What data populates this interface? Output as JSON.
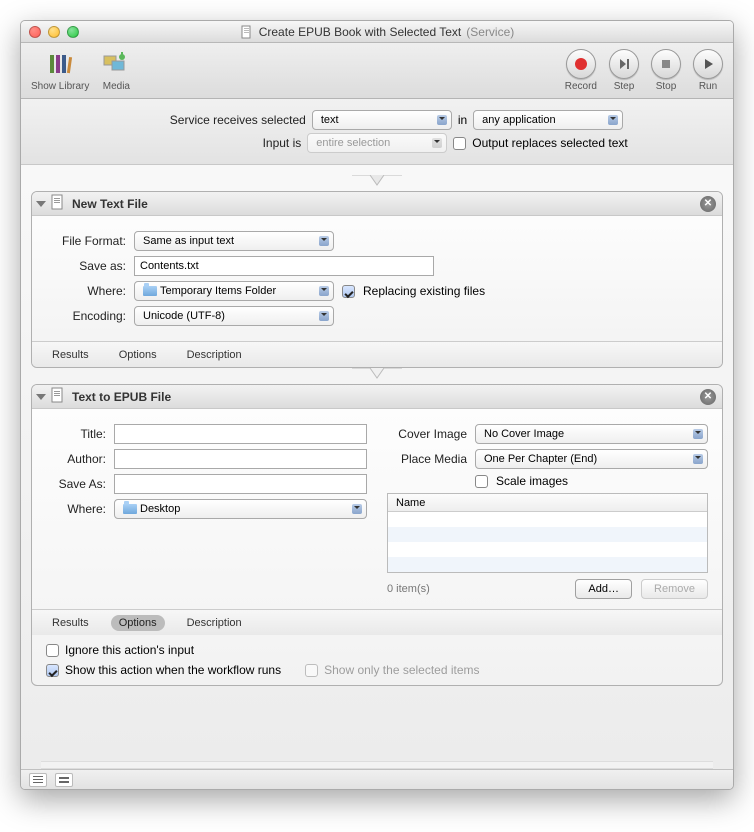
{
  "window": {
    "title": "Create EPUB Book with Selected Text",
    "title_suffix": "(Service)"
  },
  "toolbar": {
    "show_library": "Show Library",
    "media": "Media",
    "record": "Record",
    "step": "Step",
    "stop": "Stop",
    "run": "Run"
  },
  "config": {
    "receives_label": "Service receives selected",
    "receives_value": "text",
    "in_label": "in",
    "in_value": "any application",
    "input_is_label": "Input is",
    "input_is_value": "entire selection",
    "output_replaces_label": "Output replaces selected text",
    "output_replaces_checked": false
  },
  "action1": {
    "title": "New Text File",
    "file_format_label": "File Format:",
    "file_format_value": "Same as input text",
    "save_as_label": "Save as:",
    "save_as_value": "Contents.txt",
    "where_label": "Where:",
    "where_value": "Temporary Items Folder",
    "replacing_label": "Replacing existing files",
    "replacing_checked": true,
    "encoding_label": "Encoding:",
    "encoding_value": "Unicode (UTF-8)",
    "tabs": {
      "results": "Results",
      "options": "Options",
      "description": "Description"
    }
  },
  "action2": {
    "title": "Text to EPUB File",
    "title_label": "Title:",
    "title_value": "",
    "author_label": "Author:",
    "author_value": "",
    "save_as_label": "Save As:",
    "save_as_value": "",
    "where_label": "Where:",
    "where_value": "Desktop",
    "cover_image_label": "Cover Image",
    "cover_image_value": "No Cover Image",
    "place_media_label": "Place Media",
    "place_media_value": "One Per Chapter (End)",
    "scale_images_label": "Scale images",
    "scale_images_checked": false,
    "table_header": "Name",
    "item_count": "0 item(s)",
    "add_btn": "Add…",
    "remove_btn": "Remove",
    "tabs": {
      "results": "Results",
      "options": "Options",
      "description": "Description",
      "active": "options"
    },
    "opt_ignore": "Ignore this action's input",
    "opt_ignore_checked": false,
    "opt_show": "Show this action when the workflow runs",
    "opt_show_checked": true,
    "opt_show_only": "Show only the selected items",
    "opt_show_only_checked": false
  }
}
